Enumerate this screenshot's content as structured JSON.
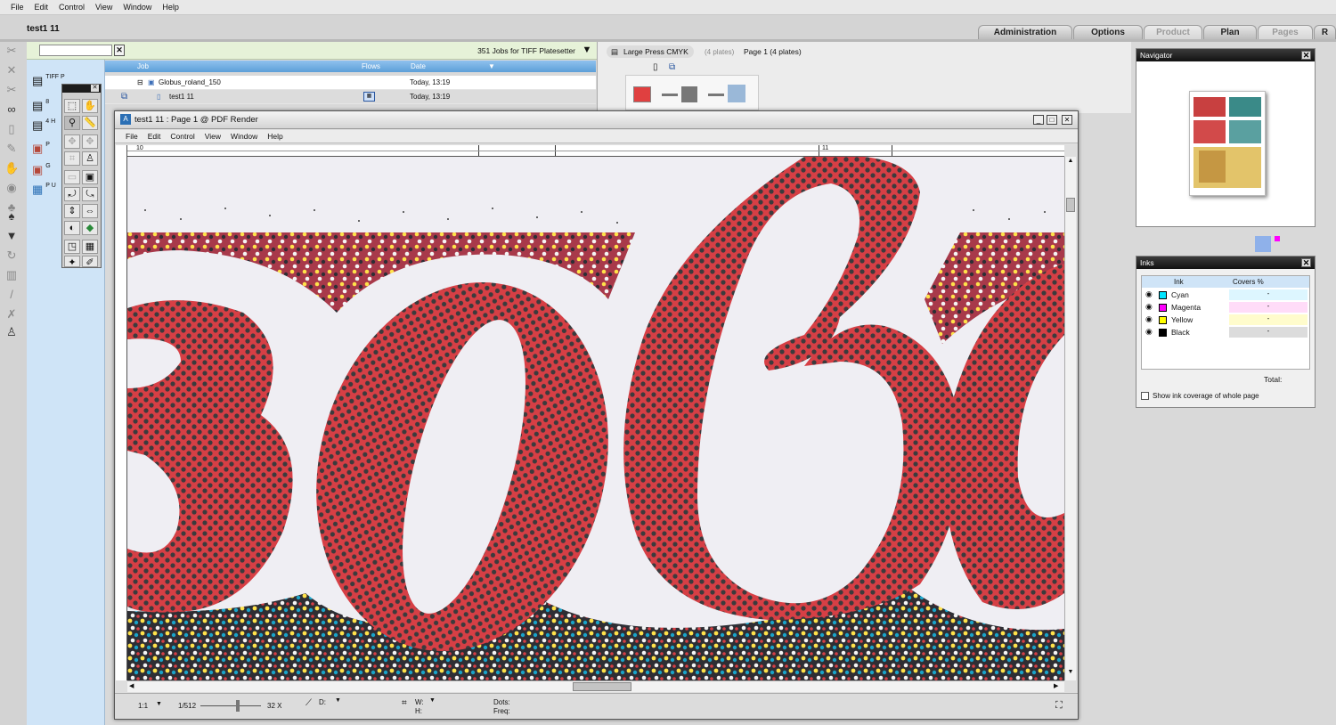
{
  "menu": [
    "File",
    "Edit",
    "Control",
    "View",
    "Window",
    "Help"
  ],
  "app_title": "test1 11",
  "tabs": [
    {
      "label": "Administration",
      "enabled": true
    },
    {
      "label": "Options",
      "enabled": true
    },
    {
      "label": "Product",
      "enabled": false
    },
    {
      "label": "Plan",
      "enabled": true
    },
    {
      "label": "Pages",
      "enabled": false
    },
    {
      "label": "R",
      "enabled": true
    }
  ],
  "blue_panel": [
    {
      "icon": "printer-icon",
      "text": "TIFF P"
    },
    {
      "icon": "printer-icon",
      "text": "8"
    },
    {
      "icon": "printer-icon",
      "text": "4 H"
    },
    {
      "icon": "printer-icon",
      "text": "P"
    },
    {
      "icon": "printer-icon",
      "text": "G"
    },
    {
      "icon": "printer-icon",
      "text": "P U"
    }
  ],
  "jobs": {
    "search_value": "",
    "count_label": "351 Jobs for TIFF Platesetter",
    "columns": [
      "Job",
      "Flows",
      "Date"
    ],
    "rows": [
      {
        "name": "Globus_roland_150",
        "date": "Today, 13:19",
        "selected": false
      },
      {
        "name": "test1 11",
        "date": "Today, 13:19",
        "selected": true
      }
    ]
  },
  "plates": {
    "preset": "Large Press CMYK",
    "plates_count": "(4 plates)",
    "page_label": "Page 1 (4 plates)"
  },
  "navigator": {
    "title": "Navigator"
  },
  "inks": {
    "title": "Inks",
    "columns": [
      "Ink",
      "Covers %"
    ],
    "rows": [
      {
        "name": "Cyan",
        "color": "#00e5ff",
        "value": "-",
        "bg": "#ddf6ff"
      },
      {
        "name": "Magenta",
        "color": "#ff00ff",
        "value": "-",
        "bg": "#ffdcf8"
      },
      {
        "name": "Yellow",
        "color": "#ffff00",
        "value": "-",
        "bg": "#fffccc"
      },
      {
        "name": "Black",
        "color": "#000000",
        "value": "-",
        "bg": "#dcdcdc"
      }
    ],
    "total_label": "Total:",
    "whole_page_label": "Show ink coverage of whole page"
  },
  "render_window": {
    "title": "test1 11 : Page 1 @ PDF Render",
    "menu": [
      "File",
      "Edit",
      "Control",
      "View",
      "Window",
      "Help"
    ],
    "ruler_top_labels": [
      "10",
      "11"
    ],
    "status": {
      "zoom": "1:1",
      "scale": "1/512",
      "scale_max": "32 X",
      "d_label": "D:",
      "w_label": "W:",
      "h_label": "H:",
      "dots_label": "Dots:",
      "freq_label": "Freq:"
    },
    "zoom_slider": 0.62
  },
  "colors": {
    "red_ink": "#d63f45",
    "dot": "#3b3b3d",
    "paper": "#efeef3",
    "blue_panel": "#cfe4f7",
    "jobs_header": "#5d9fd8"
  }
}
